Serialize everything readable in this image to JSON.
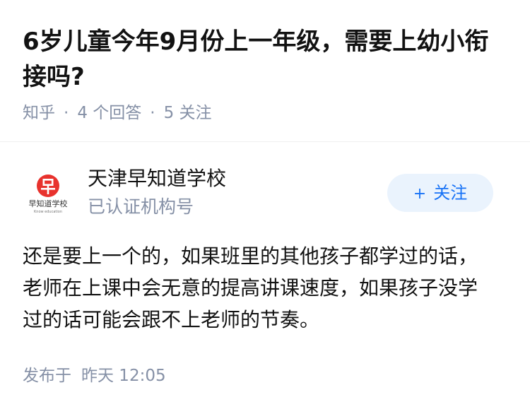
{
  "question": {
    "title": "6岁儿童今年9月份上一年级，需要上幼小衔接吗?",
    "source": "知乎",
    "separator": "·",
    "answer_count": "4 个回答",
    "follower_count": "5 关注"
  },
  "answer": {
    "author": {
      "name": "天津早知道学校",
      "subtitle": "已认证机构号",
      "avatar_text": "早知道学校",
      "avatar_subtext": "Know education",
      "avatar_icon": "zao-badge-icon"
    },
    "follow_button": {
      "plus": "+",
      "label": "关注"
    },
    "content": "还是要上一个的，如果班里的其他孩子都学过的话，老师在上课中会无意的提高讲课速度，如果孩子没学过的话可能会跟不上老师的节奏。",
    "published_label": "发布于",
    "published_time": "昨天 12:05"
  },
  "colors": {
    "text_primary": "#121212",
    "text_secondary": "#8590a6",
    "accent": "#1772f6",
    "accent_bg": "#eaf3fd",
    "logo_red": "#e8322d"
  }
}
